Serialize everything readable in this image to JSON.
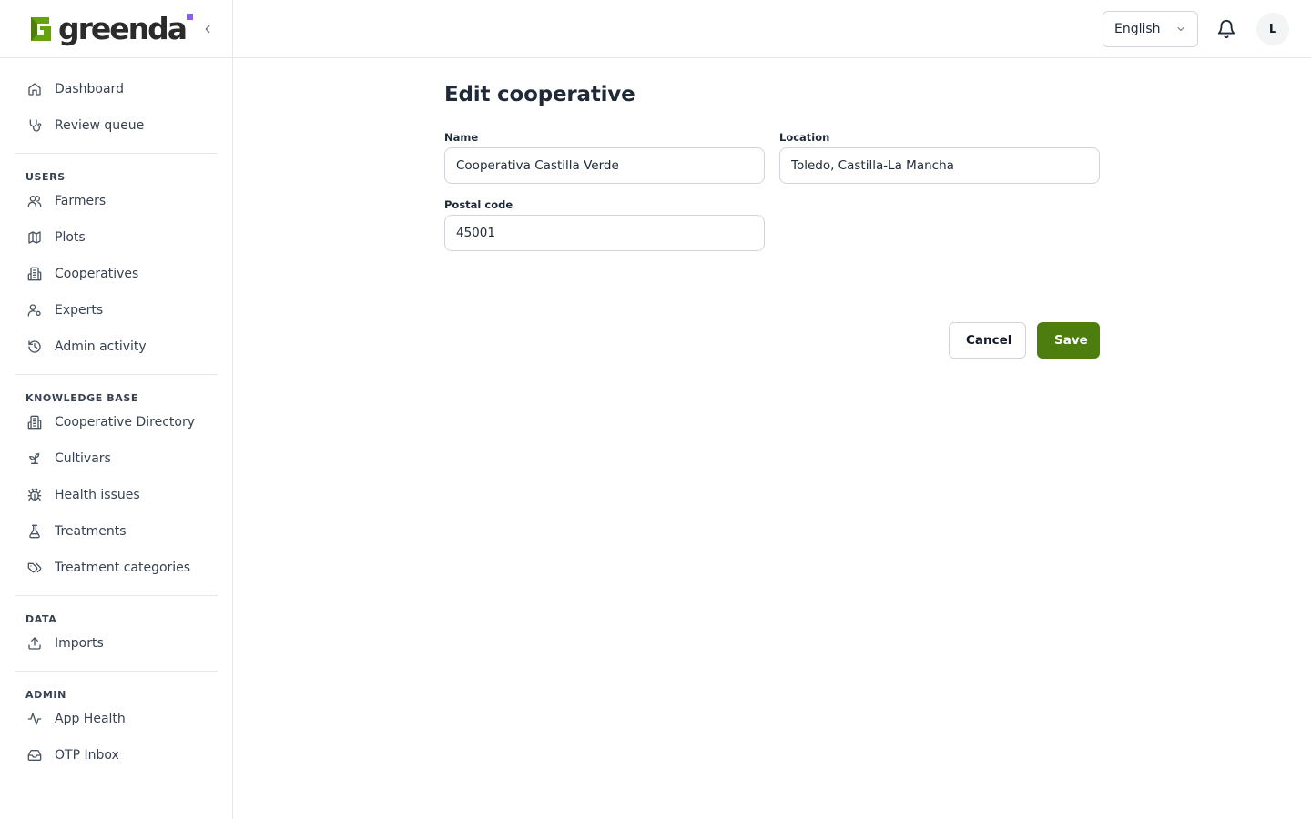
{
  "brand": {
    "name": "greenda",
    "accent": "#8b5cf6",
    "mark_color": "#65a30d"
  },
  "sidebar": {
    "top_items": [
      {
        "label": "Dashboard",
        "icon": "home-icon"
      },
      {
        "label": "Review queue",
        "icon": "stethoscope-icon"
      }
    ],
    "sections": [
      {
        "title": "USERS",
        "items": [
          {
            "label": "Farmers",
            "icon": "users-icon"
          },
          {
            "label": "Plots",
            "icon": "map-icon"
          },
          {
            "label": "Cooperatives",
            "icon": "building-icon"
          },
          {
            "label": "Experts",
            "icon": "user-cog-icon"
          },
          {
            "label": "Admin activity",
            "icon": "history-icon"
          }
        ]
      },
      {
        "title": "KNOWLEDGE BASE",
        "items": [
          {
            "label": "Cooperative Directory",
            "icon": "building-icon"
          },
          {
            "label": "Cultivars",
            "icon": "sprout-icon"
          },
          {
            "label": "Health issues",
            "icon": "bug-icon"
          },
          {
            "label": "Treatments",
            "icon": "flask-icon"
          },
          {
            "label": "Treatment categories",
            "icon": "tags-icon"
          }
        ]
      },
      {
        "title": "DATA",
        "items": [
          {
            "label": "Imports",
            "icon": "upload-icon"
          }
        ]
      },
      {
        "title": "ADMIN",
        "items": [
          {
            "label": "App Health",
            "icon": "activity-icon"
          },
          {
            "label": "OTP Inbox",
            "icon": "inbox-icon"
          }
        ]
      }
    ]
  },
  "topbar": {
    "language": "English",
    "avatar_initial": "L"
  },
  "page": {
    "title": "Edit cooperative",
    "fields": {
      "name": {
        "label": "Name",
        "value": "Cooperativa Castilla Verde"
      },
      "location": {
        "label": "Location",
        "value": "Toledo, Castilla-La Mancha"
      },
      "postal_code": {
        "label": "Postal code",
        "value": "45001"
      }
    },
    "actions": {
      "cancel": "Cancel",
      "save": "Save"
    }
  }
}
